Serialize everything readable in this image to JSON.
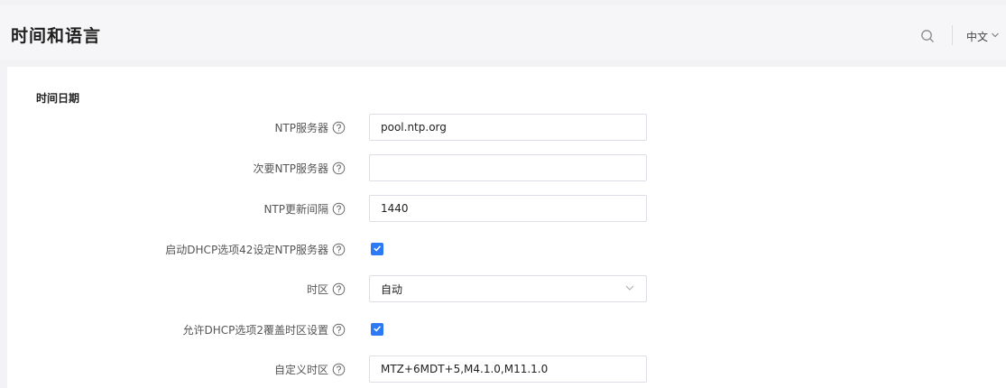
{
  "header": {
    "title": "时间和语言",
    "language": "中文"
  },
  "section": {
    "title": "时间日期"
  },
  "form": {
    "ntp_server": {
      "label": "NTP服务器",
      "value": "pool.ntp.org"
    },
    "secondary_ntp_server": {
      "label": "次要NTP服务器",
      "value": ""
    },
    "ntp_update_interval": {
      "label": "NTP更新间隔",
      "value": "1440"
    },
    "dhcp_option42": {
      "label": "启动DHCP选项42设定NTP服务器",
      "checked": true
    },
    "timezone": {
      "label": "时区",
      "value": "自动"
    },
    "dhcp_option2": {
      "label": "允许DHCP选项2覆盖时区设置",
      "checked": true
    },
    "custom_timezone": {
      "label": "自定义时区",
      "value": "MTZ+6MDT+5,M4.1.0,M11.1.0"
    }
  },
  "colors": {
    "accent": "#2d78f4",
    "page_bg": "#f3f3f6",
    "card_bg": "#ffffff",
    "border": "#dcdfe6"
  },
  "icons": {
    "search": "search-icon",
    "help": "question-circle-icon",
    "chevron": "chevron-down-icon",
    "check": "check-icon"
  }
}
